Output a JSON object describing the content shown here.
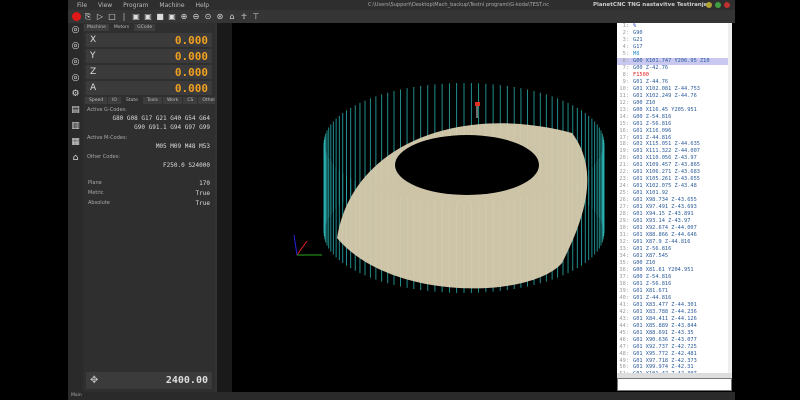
{
  "window": {
    "path": "C:\\Users\\Support\\Desktop\\Mach_backup\\Testni programi\\G-koda\\TEST.nc",
    "title": "PlanetCNC TNG nastavitve Testiranje"
  },
  "menu": [
    "File",
    "View",
    "Program",
    "Machine",
    "Help"
  ],
  "tabs": [
    "Machine",
    "Motors",
    "GCode"
  ],
  "axes": [
    {
      "name": "X",
      "value": "0.000"
    },
    {
      "name": "Y",
      "value": "0.000"
    },
    {
      "name": "Z",
      "value": "0.000"
    },
    {
      "name": "A",
      "value": "0.000"
    }
  ],
  "subtabs": [
    "Speed",
    "IO",
    "State",
    "Tools",
    "Work",
    "CS",
    "Other"
  ],
  "state": {
    "gcodes_label": "Active G-Codes:",
    "gcodes_1": "G80 G08 G17 G21 G40 G54 G64",
    "gcodes_2": "G90 G91.1 G94 G97 G99",
    "mcodes_label": "Active M-Codes:",
    "mcodes": "M05 M09 M48 M53",
    "other_label": "Other Codes:",
    "other": "F250.0 S24000",
    "plane_label": "Plane",
    "plane": "170",
    "metric_label": "Metric",
    "metric": "True",
    "absolute_label": "Absolute",
    "absolute": "True"
  },
  "feed": "2400.00",
  "status": "Main",
  "colors": {
    "accent": "#f0a020",
    "toolpath": "#2ab0b0",
    "surface": "#d8ceb0"
  },
  "gcode": {
    "highlighted": 6,
    "lines": [
      "%",
      "G90",
      "G21",
      "G17",
      "M8",
      "G00 X101.747 Y206.95 Z10",
      "G00 Z-42.76",
      "F1500",
      "G01 Z-44.76",
      "G01 X102.081 Z-44.753",
      "G01 X102.249 Z-44.76",
      "G00 Z10",
      "G00 X116.45 Y205.951",
      "G00 Z-54.816",
      "G01 Z-56.816",
      "G01 X116.096",
      "G01 Z-44.816",
      "G01 X115.051 Z-44.635",
      "G01 X111.322 Z-44.007",
      "G01 X110.056 Z-43.97",
      "G01 X109.457 Z-43.865",
      "G01 X106.271 Z-43.683",
      "G01 X105.261 Z-43.655",
      "G01 X102.075 Z-43.48",
      "G01 X101.92",
      "G01 X98.734 Z-43.655",
      "G01 X97.491 Z-43.693",
      "G01 X94.15 Z-43.891",
      "G01 X93.14 Z-43.97",
      "G01 X92.674 Z-44.007",
      "G01 X88.866 Z-44.646",
      "G01 X87.9 Z-44.816",
      "G01 Z-56.816",
      "G01 X87.545",
      "G00 Z10",
      "G00 X81.61 Y204.951",
      "G00 Z-54.816",
      "G01 Z-56.816",
      "G01 X81.671",
      "G01 Z-44.816",
      "G01 X83.477 Z-44.301",
      "G01 X83.788 Z-44.236",
      "G01 X84.411 Z-44.126",
      "G01 X85.889 Z-43.844",
      "G01 X88.691 Z-43.35",
      "G01 X90.636 Z-43.077",
      "G01 X92.737 Z-42.725",
      "G01 X95.772 Z-42.481",
      "G01 X97.718 Z-42.373",
      "G01 X99.974 Z-42.31",
      "G01 X101.42 Z-42.307"
    ]
  }
}
